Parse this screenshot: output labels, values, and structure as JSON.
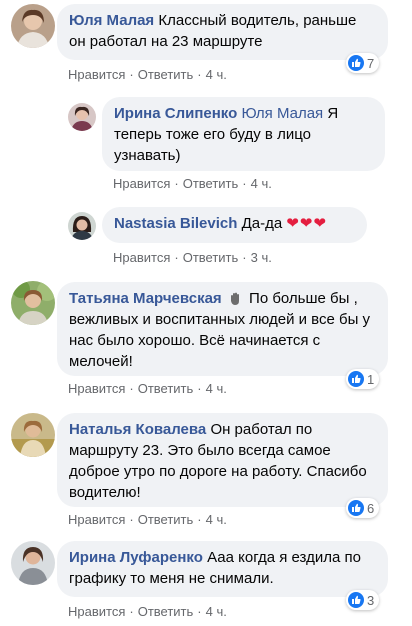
{
  "actions": {
    "like": "Нравится",
    "reply": "Ответить",
    "sep": "·"
  },
  "comments": [
    {
      "author": "Юля Малая",
      "text": "Классный водитель, раньше он работал на 23 маршруте",
      "time": "4 ч.",
      "reaction_count": "7"
    },
    {
      "author": "Ирина Слипенко",
      "mention": "Юля Малая",
      "text": "Я теперь тоже его буду в лицо узнавать)",
      "time": "4 ч."
    },
    {
      "author": "Nastasia Bilevich",
      "text": "Да-да",
      "emoji": "❤❤❤",
      "time": "3 ч."
    },
    {
      "author": "Татьяна Марчевская",
      "text": "По больше бы , вежливых и воспитанных людей и все бы у нас было хорошо. Всё начинается с мелочей!",
      "time": "4 ч.",
      "reaction_count": "1"
    },
    {
      "author": "Наталья Ковалева",
      "text": "Он работал по маршруту 23. Это было всегда самое доброе утро по дороге на работу. Спасибо водителю!",
      "time": "4 ч.",
      "reaction_count": "6"
    },
    {
      "author": "Ирина Луфаренко",
      "text": "Ааа когда я ездила по графику то меня не снимали.",
      "time": "4 ч.",
      "reaction_count": "3"
    }
  ],
  "colors": {
    "link": "#385898",
    "bubble": "#f0f2f5",
    "meta": "#65676b",
    "like": "#1877f2",
    "heart": "#e41e3f"
  }
}
